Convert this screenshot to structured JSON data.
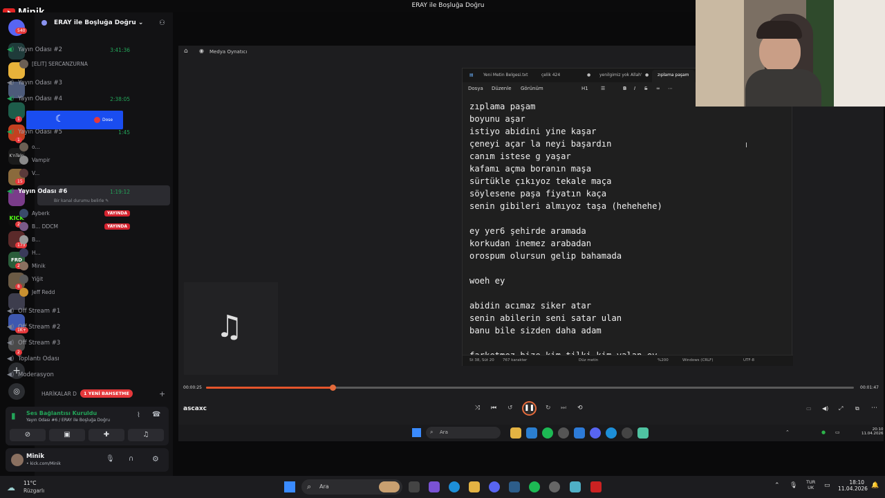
{
  "window_title": "ERAY ile Boşluğa Doğru",
  "brand": "Minik",
  "server": {
    "name": "ERAY ile Boşluğa Doğru"
  },
  "rail_badges": [
    "540",
    "1",
    "1",
    "15",
    "2",
    "173",
    "26",
    "8",
    "1K+",
    "2"
  ],
  "channels": [
    {
      "name": "Yayın Odası #2",
      "time": "3:41:36"
    },
    {
      "name": "Yayın Odası #3",
      "time": ""
    },
    {
      "name": "Yayın Odası #4",
      "time": "2:38:05"
    },
    {
      "name": "Yayın Odası #5",
      "time": "1:45"
    },
    {
      "name": "Yayın Odası #6",
      "time": "1:19:12"
    }
  ],
  "channel_status": "Bir kanal durumu belirle",
  "members_room2": [
    "[ELIT] SERCANZURNA"
  ],
  "members_room5": [
    "o...",
    "Vampir",
    "V..."
  ],
  "members_room6": [
    {
      "name": "Ayberk",
      "live": "YAYINDA"
    },
    {
      "name": "B... DDCM",
      "live": "YAYINDA"
    },
    {
      "name": "B...",
      "live": ""
    },
    {
      "name": "H...",
      "live": ""
    },
    {
      "name": "Minik",
      "live": ""
    },
    {
      "name": "Yiğit",
      "live": ""
    },
    {
      "name": "Jeff Redd",
      "live": ""
    }
  ],
  "other_channels": [
    "Off Stream #1",
    "Off Stream #2",
    "Off Stream #3",
    "Toplantı Odası",
    "Moderasyon"
  ],
  "category": "HARİKALAR D",
  "new_mention": "1 YENİ BAHSETME",
  "voice": {
    "status": "Ses Bağlantısı Kuruldu",
    "location": "Yayın Odası #6 / ERAY ile Boşluğa Doğru"
  },
  "user": {
    "name": "Minik",
    "sub": "• kick.com/Minik"
  },
  "overlay_label": "Dose",
  "media_player": {
    "app_label": "Medya Oynatıcı",
    "track": "ascaxc",
    "elapsed": "00:00:25",
    "total": "00:01:47",
    "progress_fraction": 0.195
  },
  "notepad": {
    "tabs": [
      "Yeni Metin Belgesi.txt",
      "çelik 424",
      "yenilgimiz yok Allah'",
      "zıplama paşam"
    ],
    "menu": [
      "Dosya",
      "Düzenle",
      "Görünüm"
    ],
    "heading_btn": "H1",
    "lines": [
      "zıplama paşam",
      "boyunu aşar",
      "istiyo abidini yine kaşar",
      "çeneyi açar la neyi başardın",
      "canım istese g yaşar",
      "kafamı açma boranın maşa",
      "sürtükle çıkıyoz tekale maça",
      "söylesene paşa fiyatın kaça",
      "senin gibileri almıyoz taşa (hehehehe)",
      "",
      "ey yer6 şehirde aramada",
      "korkudan inemez arabadan",
      "orospum olursun gelip bahamada",
      "",
      "woeh ey",
      "",
      "abidin acımaz siker atar",
      "senin abilerin seni satar ulan",
      "banu bile sizden daha adam",
      "",
      "farketmez bize kim tilki kim yalan ey"
    ],
    "status": [
      "St 38, Süt 20",
      "767 karakter",
      "Düz metin",
      "%200",
      "Windows (CRLF)",
      "UTF-8"
    ]
  },
  "inner_taskbar": {
    "search": "Ara",
    "time": "20:10",
    "date": "11.04.2026"
  },
  "taskbar": {
    "weather_temp": "11°C",
    "weather_desc": "Rüzgarlı",
    "search": "Ara",
    "lang_top": "TUR",
    "lang_bottom": "UK",
    "time": "18:10",
    "date": "11.04.2026"
  },
  "colors": {
    "accent": "#e5552c",
    "discord_green": "#23a559",
    "live_red": "#d4232f",
    "blue_overlay": "#1a4df0"
  }
}
